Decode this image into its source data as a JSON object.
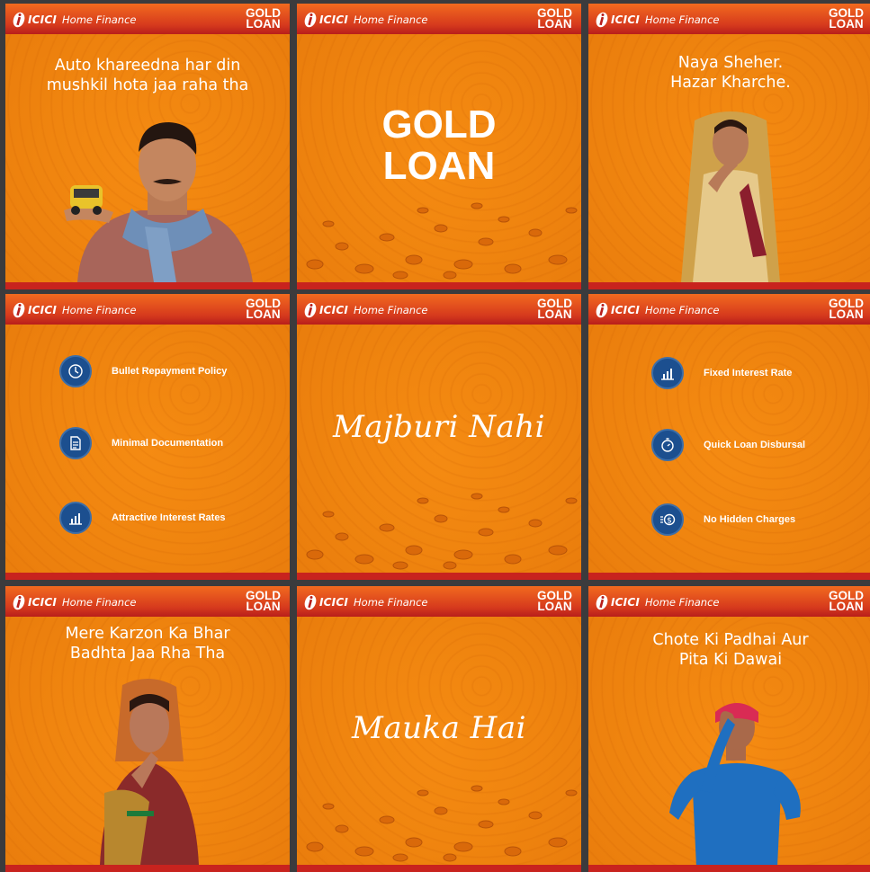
{
  "brand": {
    "name": "ICICI",
    "sub": "Home Finance"
  },
  "badge": {
    "line1": "GOLD",
    "line2": "LOAN"
  },
  "colors": {
    "orange": "#f0850f",
    "header_red": "#d63a1d",
    "footer_red": "#c8231e",
    "icon_blue": "#1c4f8f"
  },
  "tiles": {
    "t1": {
      "heading_l1": "Auto khareedna har din",
      "heading_l2": "mushkil hota jaa raha tha"
    },
    "t2": {
      "line1": "GOLD",
      "line2": "LOAN"
    },
    "t3": {
      "heading_l1": "Naya Sheher.",
      "heading_l2": "Hazar Kharche."
    },
    "t4": {
      "features": [
        {
          "icon": "clock-money-icon",
          "label": "Bullet Repayment Policy"
        },
        {
          "icon": "document-icon",
          "label": "Minimal Documentation"
        },
        {
          "icon": "rate-chart-icon",
          "label": "Attractive Interest Rates"
        }
      ]
    },
    "t5": {
      "script": "Majburi Nahi"
    },
    "t6": {
      "features": [
        {
          "icon": "rate-chart-icon",
          "label": "Fixed Interest Rate"
        },
        {
          "icon": "stopwatch-icon",
          "label": "Quick Loan Disbursal"
        },
        {
          "icon": "dollar-coin-icon",
          "label": "No Hidden Charges"
        }
      ]
    },
    "t7": {
      "heading_l1": "Mere Karzon Ka Bhar",
      "heading_l2": "Badhta Jaa Rha Tha"
    },
    "t8": {
      "script": "Mauka Hai"
    },
    "t9": {
      "heading_l1": "Chote Ki Padhai Aur",
      "heading_l2": "Pita Ki Dawai"
    }
  }
}
